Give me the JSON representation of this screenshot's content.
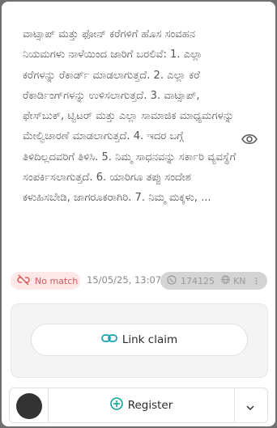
{
  "claim": {
    "text": "ವಾಟ್ಸಾಪ್ ಮತ್ತು ಫೋನ್ ಕರೆಗಳಿಗೆ ಹೊಸ ಸಂವಹನ ನಿಯಮಗಳು ನಾಳೆಯಿಂದ ಜಾರಿಗೆ ಬರಲಿವೆ: 1. ಎಲ್ಲಾ ಕರೆಗಳನ್ನು ರೆಕಾರ್ಡ್ ಮಾಡಲಾಗುತ್ತದೆ. 2. ಎಲ್ಲಾ ಕರೆ ರೆಕಾರ್ಡಿಂಗ್‌ಗಳನ್ನು ಉಳಿಸಲಾಗುತ್ತದೆ. 3. ವಾಟ್ಸಾಪ್, ಫೇಸ್‌ಬುಕ್, ಟ್ವಿಟರ್ ಮತ್ತು ಎಲ್ಲಾ ಸಾಮಾಜಿಕ ಮಾಧ್ಯಮಗಳನ್ನು ಮೇಲ್ವಿಚಾರಣೆ ಮಾಡಲಾಗುತ್ತದೆ. 4. ಇದರ ಬಗ್ಗೆ ತಿಳಿದಿಲ್ಲದವರಿಗೆ ತಿಳಿಸಿ. 5. ನಿಮ್ಮ ಸಾಧನವನ್ನು ಸರ್ಕಾರಿ ವ್ಯವಸ್ಥೆಗೆ ಸಂಪರ್ಕಿಸಲಾಗುತ್ತದೆ. 6. ಯಾರಿಗೂ ತಪ್ಪು ಸಂದೇಶ ಕಳುಹಿಸಬೇಡಿ, ಜಾಗರೂಕರಾಗಿರಿ. 7. ನಿಮ್ಮ ಮಕ್ಕಳು, ..."
  },
  "status": {
    "label": "No match",
    "color": "#d45b5b",
    "icon": "link-off-icon"
  },
  "timestamp": "15/05/25, 13:07",
  "stats": {
    "count": "174125",
    "language": "KN",
    "icons": [
      "whatsapp-icon",
      "globe-icon",
      "more-icon"
    ]
  },
  "actions": {
    "link_claim_label": "Link claim",
    "register_label": "Register"
  },
  "colors": {
    "accent": "#17a2b8",
    "register_accent": "#14a39a"
  }
}
